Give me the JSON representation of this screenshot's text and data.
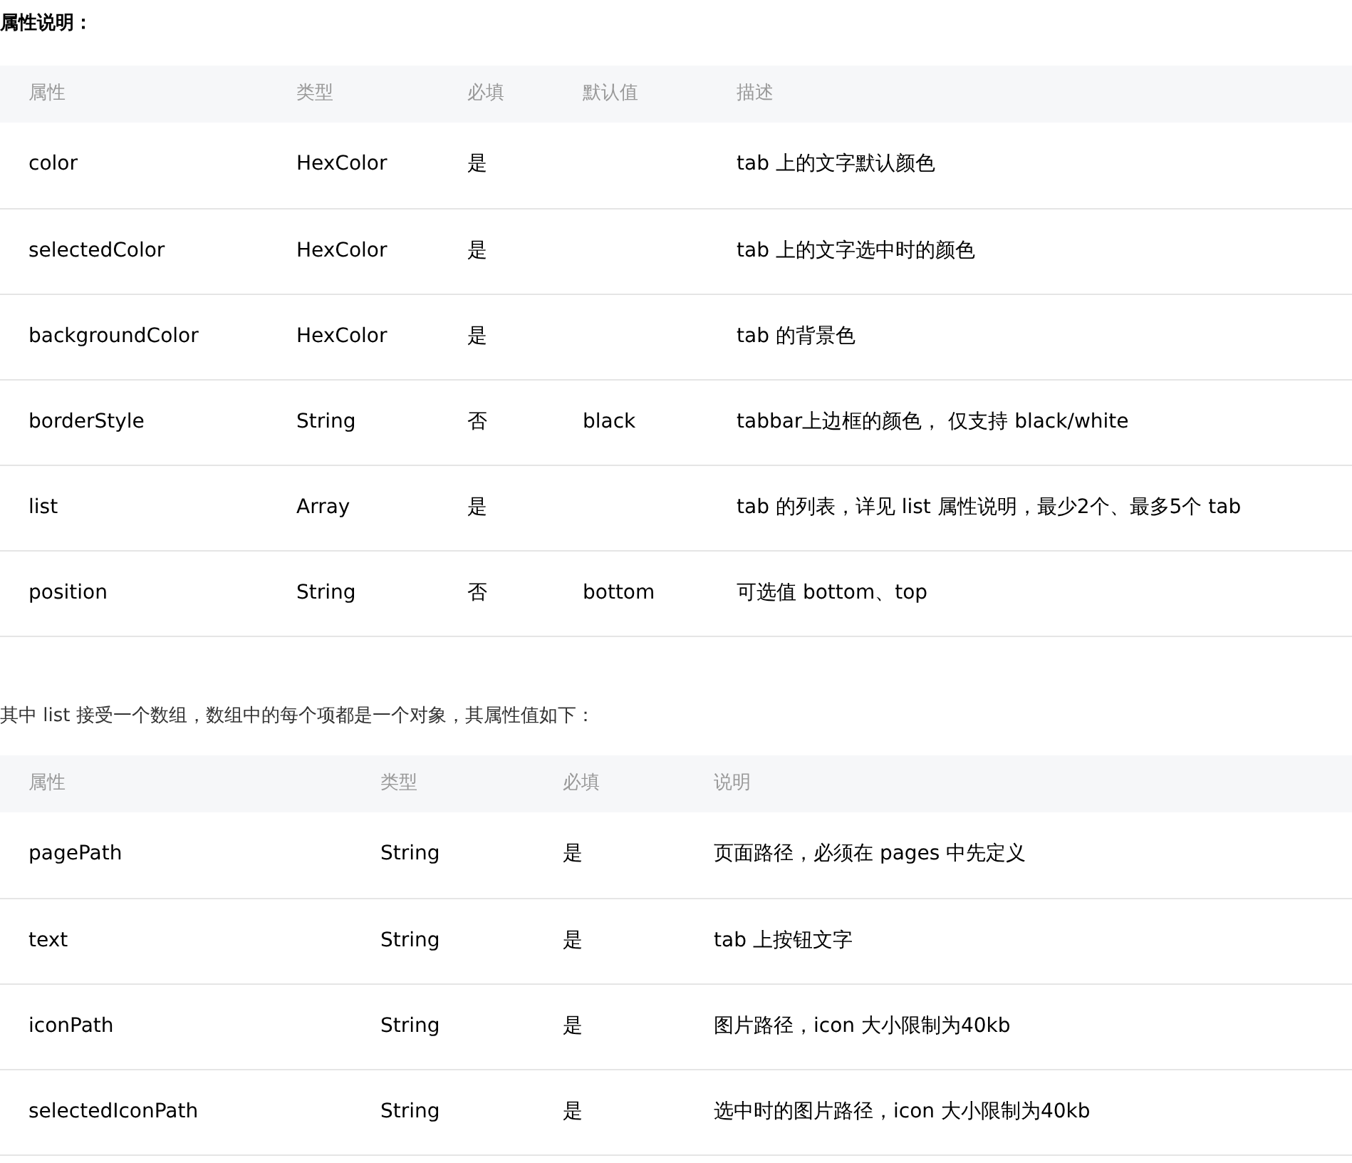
{
  "section_title": "属性说明：",
  "table_1": {
    "columns": [
      "属性",
      "类型",
      "必填",
      "默认值",
      "描述"
    ],
    "rows": [
      {
        "name": "color",
        "type": "HexColor",
        "required": "是",
        "description": "tab 上的文字默认颜色"
      },
      {
        "name": "selectedColor",
        "type": "HexColor",
        "required": "是",
        "description": "tab 上的文字选中时的颜色"
      },
      {
        "name": "backgroundColor",
        "type": "HexColor",
        "required": "是",
        "description": "tab 的背景色"
      },
      {
        "name": "borderStyle",
        "type": "String",
        "required": "否",
        "default": "black",
        "description": "tabbar上边框的颜色， 仅支持 black/white"
      },
      {
        "name": "list",
        "type": "Array",
        "required": "是",
        "description": "tab 的列表，详见 list 属性说明，最少2个、最多5个 tab"
      },
      {
        "name": "position",
        "type": "String",
        "required": "否",
        "default": "bottom",
        "description": "可选值 bottom、top"
      }
    ]
  },
  "note": "其中 list 接受一个数组，数组中的每个项都是一个对象，其属性值如下：",
  "table_2": {
    "columns": [
      "属性",
      "类型",
      "必填",
      "说明"
    ],
    "rows": [
      {
        "name": "pagePath",
        "type": "String",
        "required": "是",
        "description": "页面路径，必须在 pages 中先定义"
      },
      {
        "name": "text",
        "type": "String",
        "required": "是",
        "description": "tab 上按钮文字"
      },
      {
        "name": "iconPath",
        "type": "String",
        "required": "是",
        "description": "图片路径，icon 大小限制为40kb"
      },
      {
        "name": "selectedIconPath",
        "type": "String",
        "required": "是",
        "description": "选中时的图片路径，icon 大小限制为40kb"
      }
    ]
  }
}
